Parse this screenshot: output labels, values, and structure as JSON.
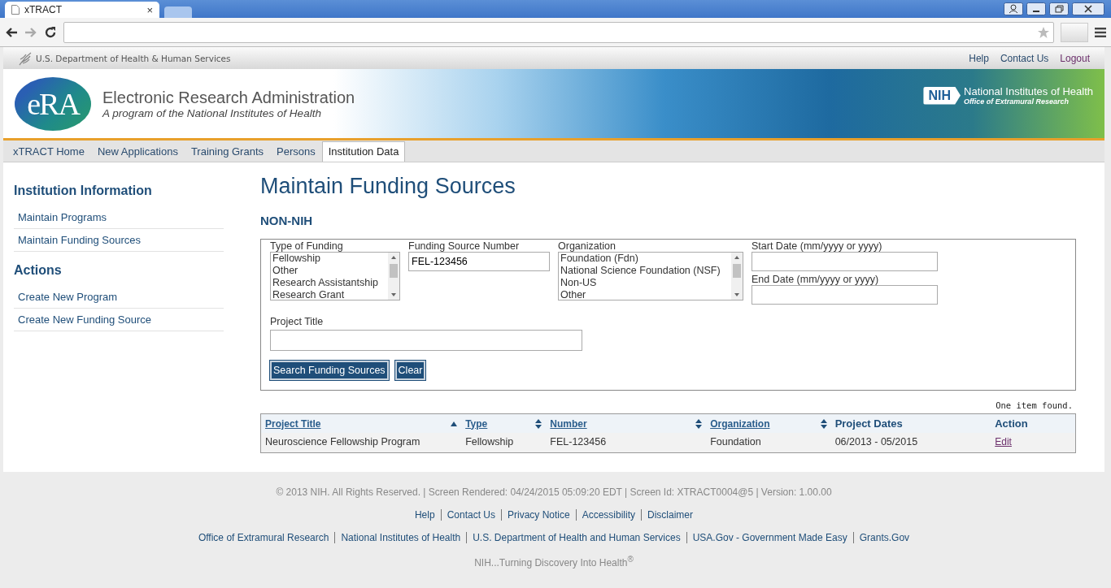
{
  "browser": {
    "tab_title": "xTRACT",
    "tab_close": "×"
  },
  "gov_bar": {
    "agency": "U.S. Department of Health & Human Services",
    "links": [
      {
        "label": "Help",
        "visited": false
      },
      {
        "label": "Contact Us",
        "visited": false
      },
      {
        "label": "Logout",
        "visited": true
      }
    ]
  },
  "banner": {
    "logo_text": "eRA",
    "title": "Electronic Research Administration",
    "subtitle": "A program of the National Institutes of Health",
    "nih_badge": "NIH",
    "nih_title": "National Institutes of Health",
    "nih_subtitle": "Office of  Extramural Research"
  },
  "nav_tabs": [
    {
      "label": "xTRACT Home",
      "selected": false
    },
    {
      "label": "New Applications",
      "selected": false
    },
    {
      "label": "Training Grants",
      "selected": false
    },
    {
      "label": "Persons",
      "selected": false
    },
    {
      "label": "Institution Data",
      "selected": true
    }
  ],
  "sidebar": [
    {
      "heading": "Institution Information",
      "items": [
        "Maintain Programs",
        "Maintain Funding Sources"
      ]
    },
    {
      "heading": "Actions",
      "items": [
        "Create New Program",
        "Create New Funding Source"
      ]
    }
  ],
  "main": {
    "title": "Maintain Funding Sources",
    "subtitle": "NON-NIH",
    "form": {
      "type_of_funding": {
        "label": "Type of Funding",
        "options": [
          "Fellowship",
          "Other",
          "Research Assistantship",
          "Research Grant"
        ]
      },
      "funding_source_number": {
        "label": "Funding Source Number",
        "value": "FEL-123456"
      },
      "organization": {
        "label": "Organization",
        "options": [
          "Foundation (Fdn)",
          "National Science Foundation (NSF)",
          "Non-US",
          "Other"
        ]
      },
      "start_date": {
        "label": "Start Date (mm/yyyy or yyyy)"
      },
      "end_date": {
        "label": "End Date (mm/yyyy or yyyy)"
      },
      "project_title": {
        "label": "Project Title"
      },
      "buttons": [
        "Search Funding Sources",
        "Clear"
      ]
    },
    "result_count": "One item found.",
    "table": {
      "columns": [
        {
          "label": "Project Title",
          "sortable": true,
          "sorted": true
        },
        {
          "label": "Type",
          "sortable": true,
          "sorted": false
        },
        {
          "label": "Number",
          "sortable": true,
          "sorted": false
        },
        {
          "label": "Organization",
          "sortable": true,
          "sorted": false
        },
        {
          "label": "Project Dates",
          "sortable": false
        },
        {
          "label": "Action",
          "sortable": false
        }
      ],
      "rows": [
        {
          "cells": [
            "Neuroscience Fellowship Program",
            "Fellowship",
            "FEL-123456",
            "Foundation",
            "06/2013 - 05/2015"
          ],
          "action": "Edit",
          "action_visited": true
        }
      ]
    }
  },
  "footer": {
    "copyright": "© 2013 NIH. All Rights Reserved. | Screen Rendered: 04/24/2015 05:09:20 EDT | Screen Id: XTRACT0004@5 | Version: 1.00.00",
    "links": [
      "Help",
      "Contact Us",
      "Privacy Notice",
      "Accessibility",
      "Disclaimer"
    ],
    "agency_links": [
      "Office of Extramural Research",
      "National Institutes of Health",
      "U.S. Department of Health and Human Services",
      "USA.Gov - Government Made Easy",
      "Grants.Gov"
    ],
    "tagline": "NIH...Turning Discovery Into Health$^{®}$"
  }
}
